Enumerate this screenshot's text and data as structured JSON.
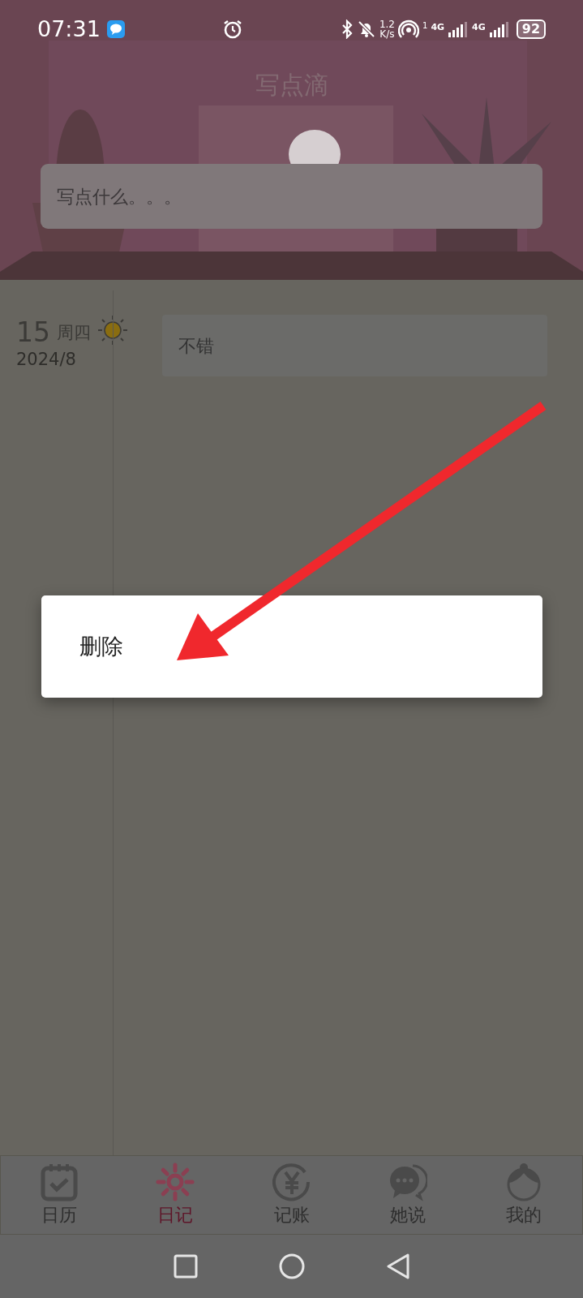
{
  "status_bar": {
    "time": "07:31",
    "speed_value": "1.2",
    "speed_unit": "K/s",
    "hotspot_badge": "1",
    "networks": [
      "4G",
      "4G"
    ],
    "battery": "92"
  },
  "header": {
    "title": "写点滴",
    "search": {
      "placeholder": "写点什么。。。"
    }
  },
  "entries": [
    {
      "day": "15",
      "weekday": "周四",
      "month": "2024/8",
      "text": "不错"
    }
  ],
  "context_menu": {
    "items": [
      "删除"
    ]
  },
  "bottom_nav": [
    {
      "label": "日历",
      "selected": false
    },
    {
      "label": "日记",
      "selected": true
    },
    {
      "label": "记账",
      "selected": false
    },
    {
      "label": "她说",
      "selected": false
    },
    {
      "label": "我的",
      "selected": false
    }
  ]
}
